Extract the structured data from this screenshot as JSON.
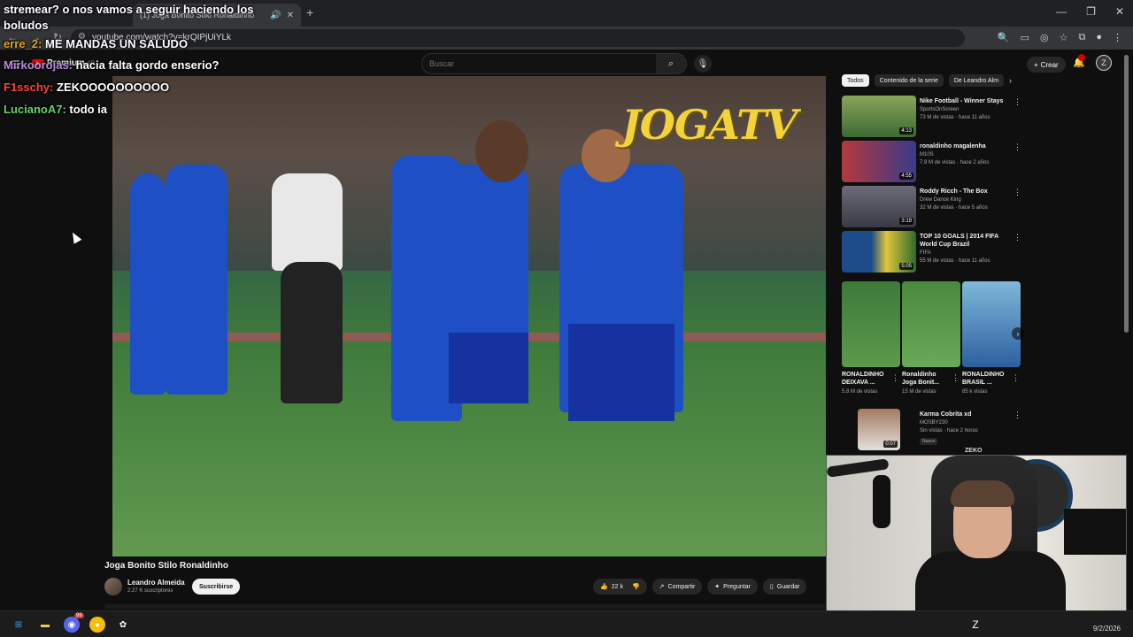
{
  "browser": {
    "tab_title": "(1) Joga Bonito Stilo Ronaldinho",
    "new_tab": "+",
    "url": "youtube.com/watch?v=krQIPjUiYLk"
  },
  "youtube": {
    "logo_text": "Premium",
    "logo_region": "AR",
    "search_placeholder": "Buscar",
    "create_label": "Crear",
    "video_overlay_text": "JOGATV",
    "video": {
      "title": "Joga Bonito Stilo Ronaldinho",
      "channel": "Leandro Almeida",
      "subscribers": "2.27 K suscriptores",
      "subscribe_label": "Suscribirse",
      "likes": "22 k",
      "share_label": "Compartir",
      "ask_label": "Preguntar",
      "save_label": "Guardar"
    },
    "chips": [
      "Todos",
      "Contenido de la serie",
      "De Leandro Alm"
    ],
    "recommendations": [
      {
        "title": "Nike Football - Winner Stays",
        "channel": "SportsOnScreen",
        "meta": "73 M de vistas · hace 11 años",
        "duration": "4:13"
      },
      {
        "title": "ronaldinho magalenha",
        "channel": "M10S",
        "meta": "7.9 M de vistas · hace 2 años",
        "duration": "4:55"
      },
      {
        "title": "Roddy Ricch - The Box",
        "channel": "Drew Dance King",
        "meta": "32 M de vistas · hace 5 años",
        "duration": "3:19"
      },
      {
        "title": "TOP 10 GOALS | 2014 FIFA World Cup Brazil",
        "channel": "FIFA",
        "meta": "55 M de vistas · hace 11 años",
        "duration": "5:05"
      }
    ],
    "shorts": [
      {
        "title": "RONALDINHO DEIXAVA ...",
        "views": "5.8 M de vistas"
      },
      {
        "title": "Ronaldinho Joga Bonit...",
        "views": "15 M de vistas"
      },
      {
        "title": "RONALDINHO BRASIL ...",
        "views": "85 k vistas"
      }
    ],
    "last_rec": {
      "title": "Karma Cobrita xd",
      "channel": "MOSBY230",
      "meta": "Sin vistas · hace 2 horas",
      "badge": "Nuevo",
      "duration": "0:07"
    }
  },
  "chat": [
    {
      "user": "",
      "text": "stremear? o nos vamos a seguir haciendo los boludos",
      "color": "#ffffff"
    },
    {
      "user": "erre_2:",
      "text": "ME MANDAS UN SALUDO",
      "color": "#daa520"
    },
    {
      "user": "Mirkoorojas:",
      "text": "hacia falta gordo enserio?",
      "color": "#b88adf"
    },
    {
      "user": "F1sschy:",
      "text": "ZEKOOOOOOOOOO",
      "color": "#ff4040"
    },
    {
      "user": "LucianoA7:",
      "text": "todo ia",
      "color": "#6bd06b"
    }
  ],
  "webcam_tag": "ZEKO",
  "taskbar": {
    "date": "9/2/2026",
    "badge": "99"
  },
  "colors": {
    "accent_red": "#ff0000",
    "background": "#0f0f0f"
  }
}
